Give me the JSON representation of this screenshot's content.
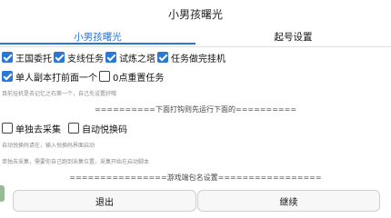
{
  "app": {
    "title": "小男孩曙光"
  },
  "tabs": [
    {
      "label": "小男孩曙光",
      "active": true
    },
    {
      "label": "起号设置",
      "active": false
    }
  ],
  "options_row1": [
    {
      "label": "王国委托",
      "checked": true
    },
    {
      "label": "支线任务",
      "checked": true
    },
    {
      "label": "试炼之塔",
      "checked": true
    },
    {
      "label": "任务做完挂机",
      "checked": true
    }
  ],
  "options_row2": [
    {
      "label": "单人副本打前面一个",
      "checked": true
    },
    {
      "label": "0点重置任务",
      "checked": false
    }
  ],
  "notes": {
    "afk": "目前挂机是去记忆之石第一个，自己先设置好哦",
    "auto_code": "自动悦换码请在，输入悦换码界面启动",
    "solo_gather": "单独去采集，需要你自己跑到采集位置，采集开始在启动脚本"
  },
  "dividers": {
    "run_below": "==========下面打钩则先运行下面的==========",
    "game_package": "================游戏端包名设置================="
  },
  "options_row3": [
    {
      "label": "单独去采集",
      "checked": false
    },
    {
      "label": "自动悦换码",
      "checked": false
    }
  ],
  "buttons": {
    "exit": "退出",
    "continue": "继续"
  },
  "colors": {
    "accent": "#2a78d6",
    "checkbox_on": "#2a78d6",
    "note_text": "#8a8a8a"
  }
}
